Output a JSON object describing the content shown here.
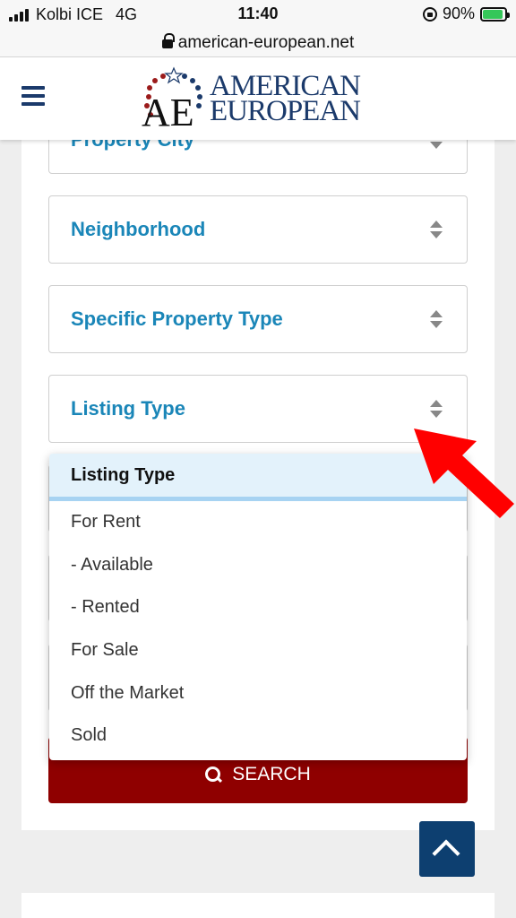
{
  "status_bar": {
    "carrier": "Kolbi ICE",
    "network": "4G",
    "time": "11:40",
    "battery": "90%",
    "battery_level": 0.9
  },
  "url_bar": {
    "url": "american-european.net"
  },
  "header": {
    "logo_monogram": "AE",
    "logo_line1": "AMERICAN",
    "logo_line2": "EUROPEAN"
  },
  "filters": {
    "property_city": "Property City",
    "neighborhood": "Neighborhood",
    "specific_property_type": "Specific Property Type",
    "listing_type": "Listing Type"
  },
  "dropdown": {
    "options": [
      "Listing Type",
      "For Rent",
      "- Available",
      "- Rented",
      "For Sale",
      "Off the Market",
      "Sold"
    ],
    "selected_index": 0
  },
  "search_button": {
    "label": "SEARCH"
  },
  "colors": {
    "accent_blue": "#1a86b8",
    "navy": "#1b3a6b",
    "search_red": "#8f0000",
    "back_to_top": "#0d3f70",
    "annotation_red": "#ff0000"
  }
}
